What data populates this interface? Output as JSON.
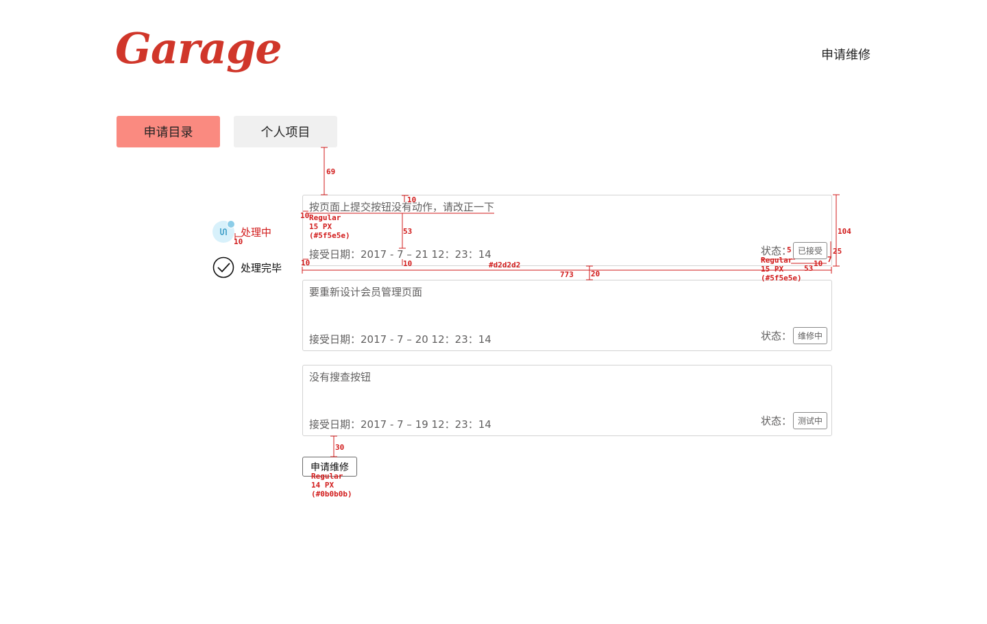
{
  "header": {
    "logo_text": "Garage",
    "top_link": "申请维修"
  },
  "tabs": [
    {
      "label": "申请目录",
      "active": true
    },
    {
      "label": "个人项目",
      "active": false
    }
  ],
  "sidebar": {
    "items": [
      {
        "label": "处理中",
        "icon": "processing-icon",
        "color": "#d11a1a"
      },
      {
        "label": "处理完毕",
        "icon": "check-circle-icon",
        "color": "#0b0b0b"
      }
    ]
  },
  "requests": [
    {
      "title": "按页面上提交按钮没有动作，请改正一下",
      "date": "接受日期：2017 - 7 – 21 12：23：14",
      "status_label": "状态：",
      "status": "已接受"
    },
    {
      "title": "要重新设计会员管理页面",
      "date": "接受日期：2017 - 7 – 20 12：23：14",
      "status_label": "状态：",
      "status": "维修中"
    },
    {
      "title": "没有搜查按钮",
      "date": "接受日期：2017 - 7 – 19 12：23：14",
      "status_label": "状态：",
      "status": "测试中"
    }
  ],
  "apply_button": "申请维修",
  "annotations": {
    "gap_tabs_card": "69",
    "title_top": "10",
    "title_left": "10",
    "title_font": [
      "Regular",
      "15 PX",
      "(#5f5e5e)"
    ],
    "title_date_gap": "53",
    "side_gap": "10",
    "date_left": "10",
    "date_bottom": "10",
    "border_color": "#d2d2d2",
    "card_width": "773",
    "card_gap": "20",
    "card_height": "104",
    "badge_height": "25",
    "badge_gap": "5",
    "badge_right": "7",
    "badge_bottom": "10",
    "badge_width": "53",
    "status_font": [
      "Regular",
      "15 PX",
      "(#5f5e5e)"
    ],
    "btn_gap": "30",
    "btn_font": [
      "Regular",
      "14 PX",
      "(#0b0b0b)"
    ]
  },
  "colors": {
    "accent": "#fa8a80",
    "logo": "#d0362a",
    "annotation": "#d11a1a",
    "text": "#5f5e5e",
    "border": "#d2d2d2"
  }
}
